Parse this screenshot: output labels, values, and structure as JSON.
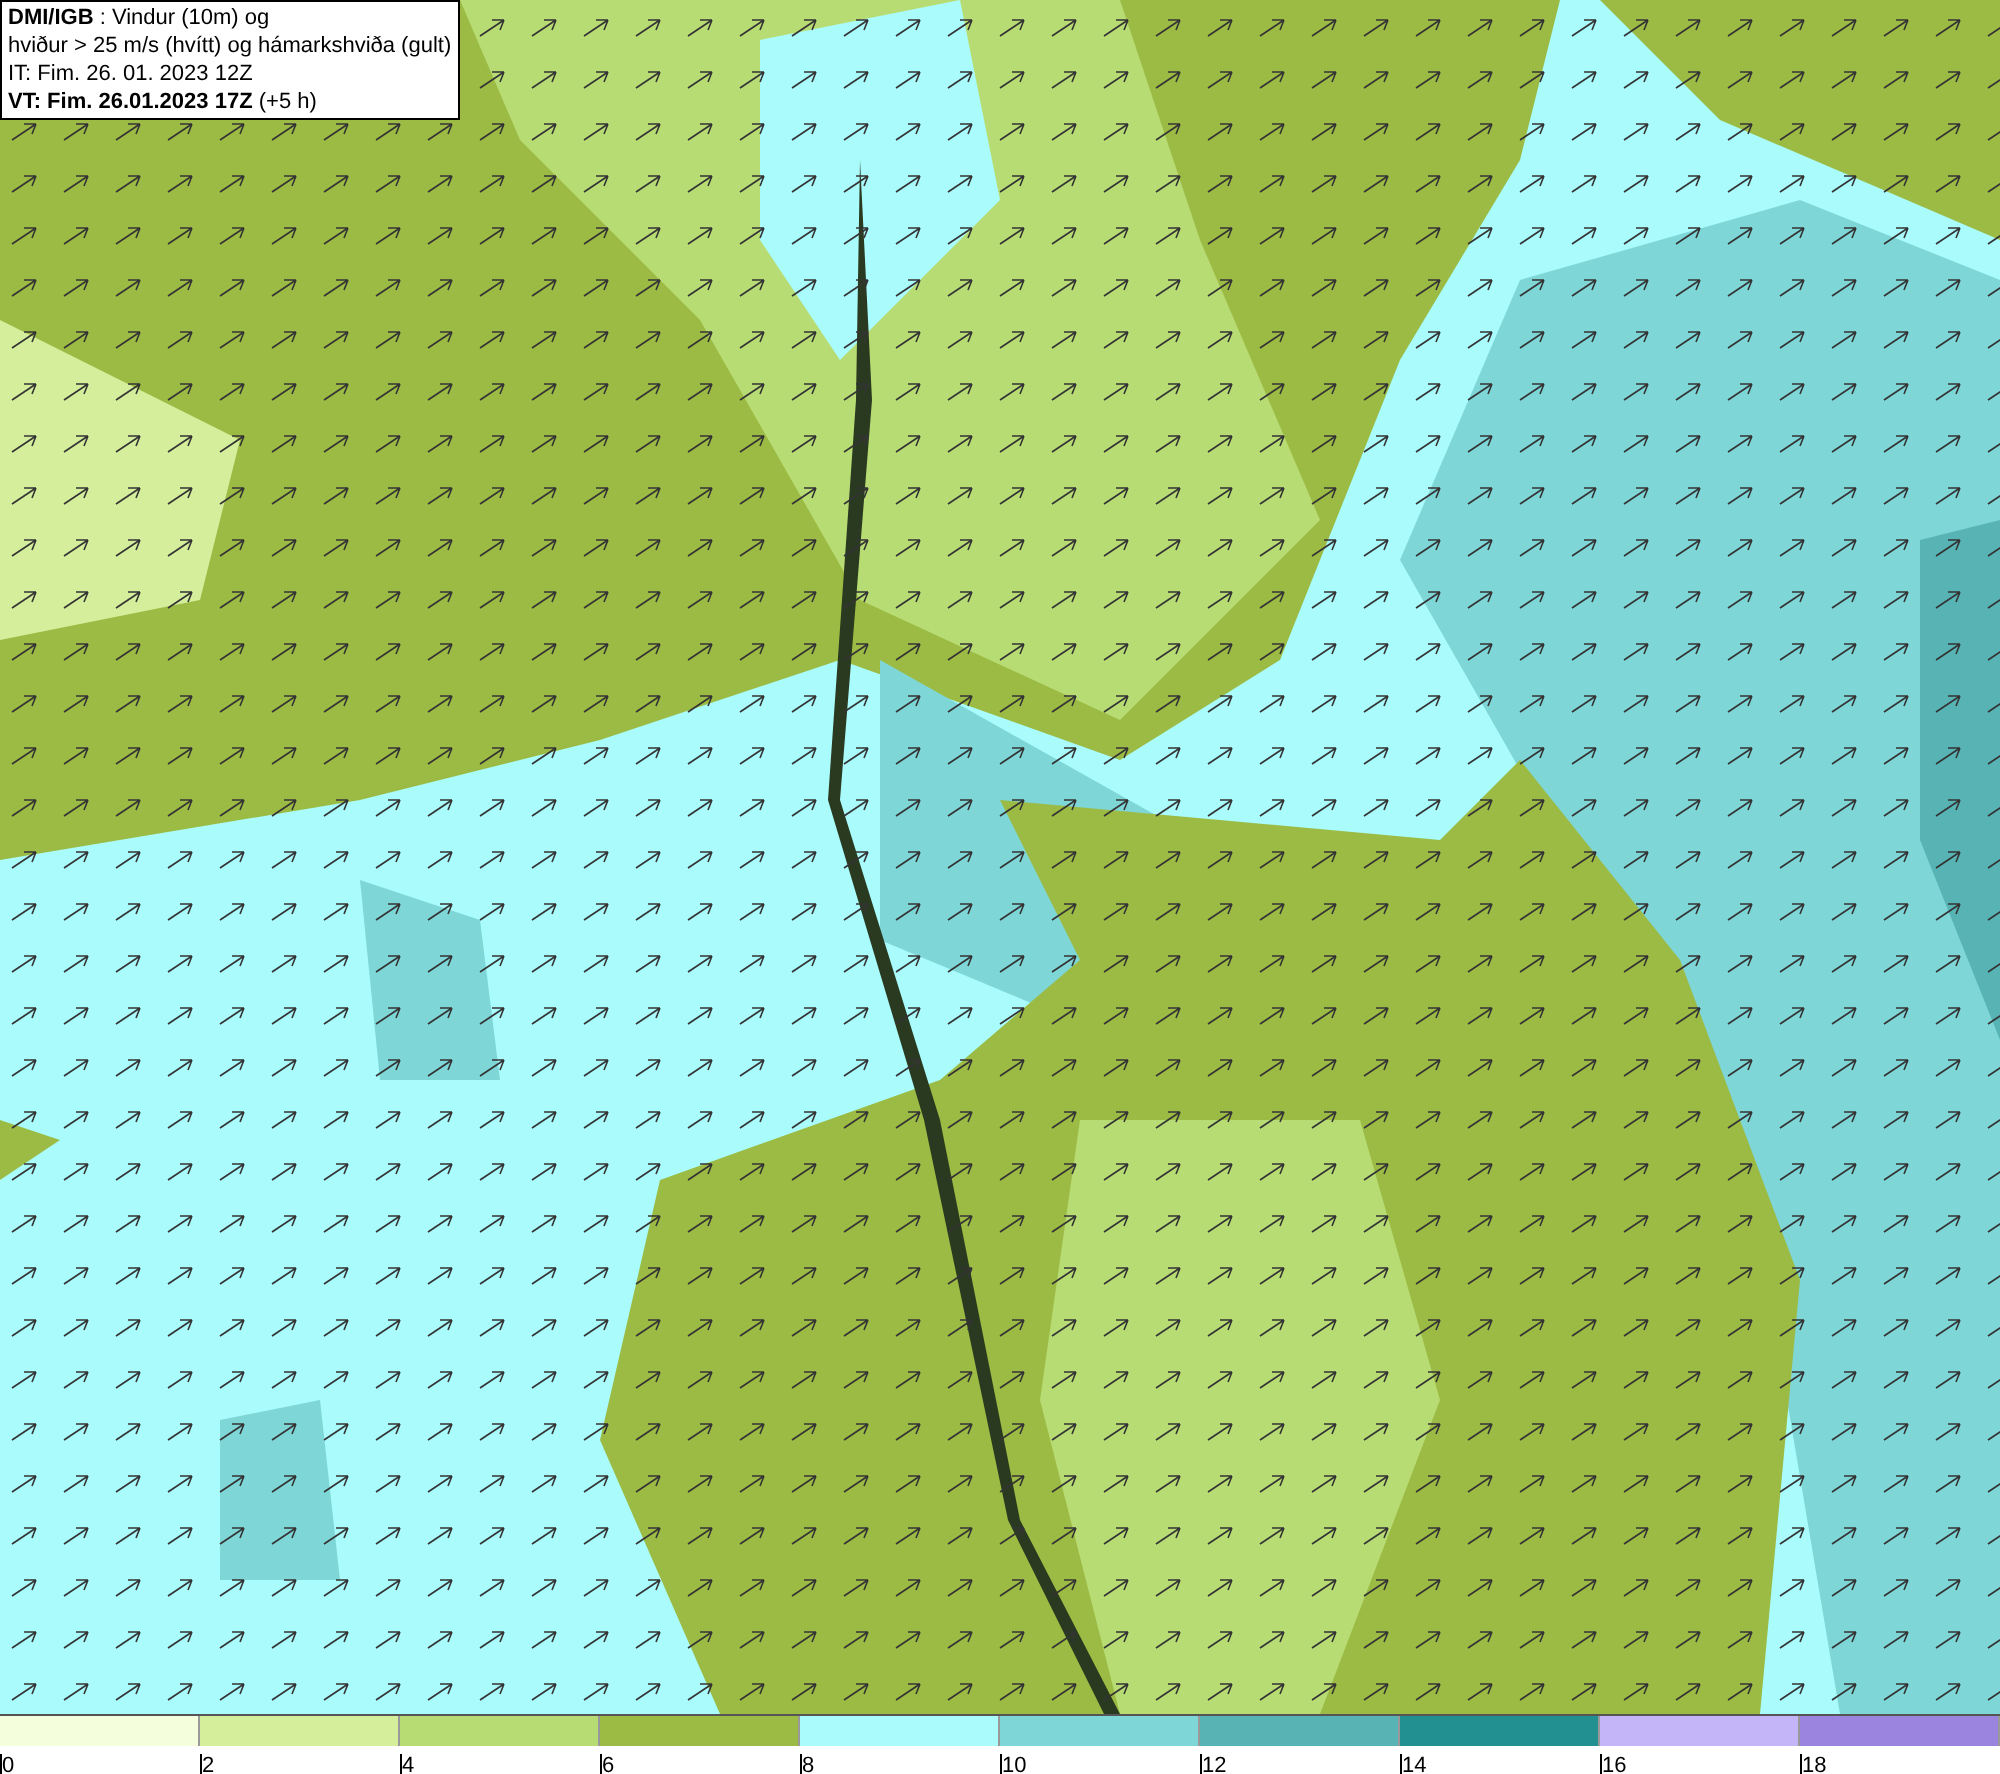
{
  "info_box": {
    "lines": [
      "**DMI/IGB** : Vindur (10m) og",
      "hviður > 25 m/s (hvítt) og hámarkshviða (gult)",
      "IT: Fim. 26. 01. 2023 12Z",
      "**VT: Fim. 26.01.2023 17Z** (+5 h)"
    ]
  },
  "legend": [
    {
      "label": "0",
      "color": "#f4fddc"
    },
    {
      "label": "2",
      "color": "#d4ee9c"
    },
    {
      "label": "4",
      "color": "#b8dc74"
    },
    {
      "label": "6",
      "color": "#9cbb44"
    },
    {
      "label": "8",
      "color": "#aafcfc"
    },
    {
      "label": "10",
      "color": "#7ed6d6"
    },
    {
      "label": "12",
      "color": "#58b4b4"
    },
    {
      "label": "14",
      "color": "#229090"
    },
    {
      "label": "16",
      "color": "#c4b4f8"
    },
    {
      "label": "18",
      "color": "#9a84e0"
    }
  ]
}
